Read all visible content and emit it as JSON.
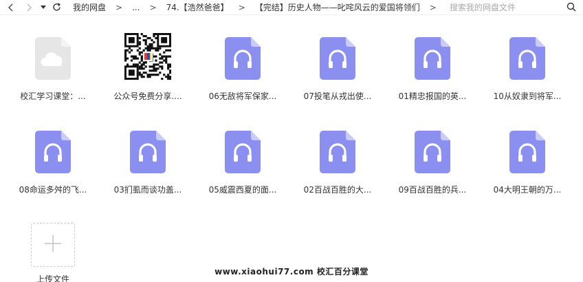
{
  "toolbar": {
    "back_icon": "chevron-left-icon",
    "forward_icon": "chevron-right-icon",
    "dropdown_icon": "caret-down-icon",
    "refresh_icon": "refresh-icon",
    "breadcrumbs": [
      "我的网盘",
      "...",
      "74.【浩然爸爸】",
      "【完结】历史人物——叱咤风云的爱国将领们"
    ],
    "separator": ">",
    "search_placeholder": "搜索我的网盘文件"
  },
  "files": [
    {
      "name": "校汇学习课堂：...",
      "type": "cloud"
    },
    {
      "name": "公众号免费分享....",
      "type": "qrcode"
    },
    {
      "name": "06无敌将军保家...",
      "type": "audio"
    },
    {
      "name": "07投笔从戎出使...",
      "type": "audio"
    },
    {
      "name": "01精忠报国的英...",
      "type": "audio"
    },
    {
      "name": "10从奴隶到将军...",
      "type": "audio"
    },
    {
      "name": "08命运多舛的飞...",
      "type": "audio"
    },
    {
      "name": "03扪虱而谈功盖...",
      "type": "audio"
    },
    {
      "name": "05威震西夏的面...",
      "type": "audio"
    },
    {
      "name": "02百战百胜的大...",
      "type": "audio"
    },
    {
      "name": "09百战百胜的兵...",
      "type": "audio"
    },
    {
      "name": "04大明王朝的万...",
      "type": "audio"
    }
  ],
  "upload": {
    "label": "上传文件"
  },
  "watermark": "www.xiaohui77.com 校汇百分课堂",
  "colors": {
    "audio_file": "#8b8ff0",
    "audio_fold": "#c9cbf8",
    "cloud_file": "#e6e6e6"
  }
}
